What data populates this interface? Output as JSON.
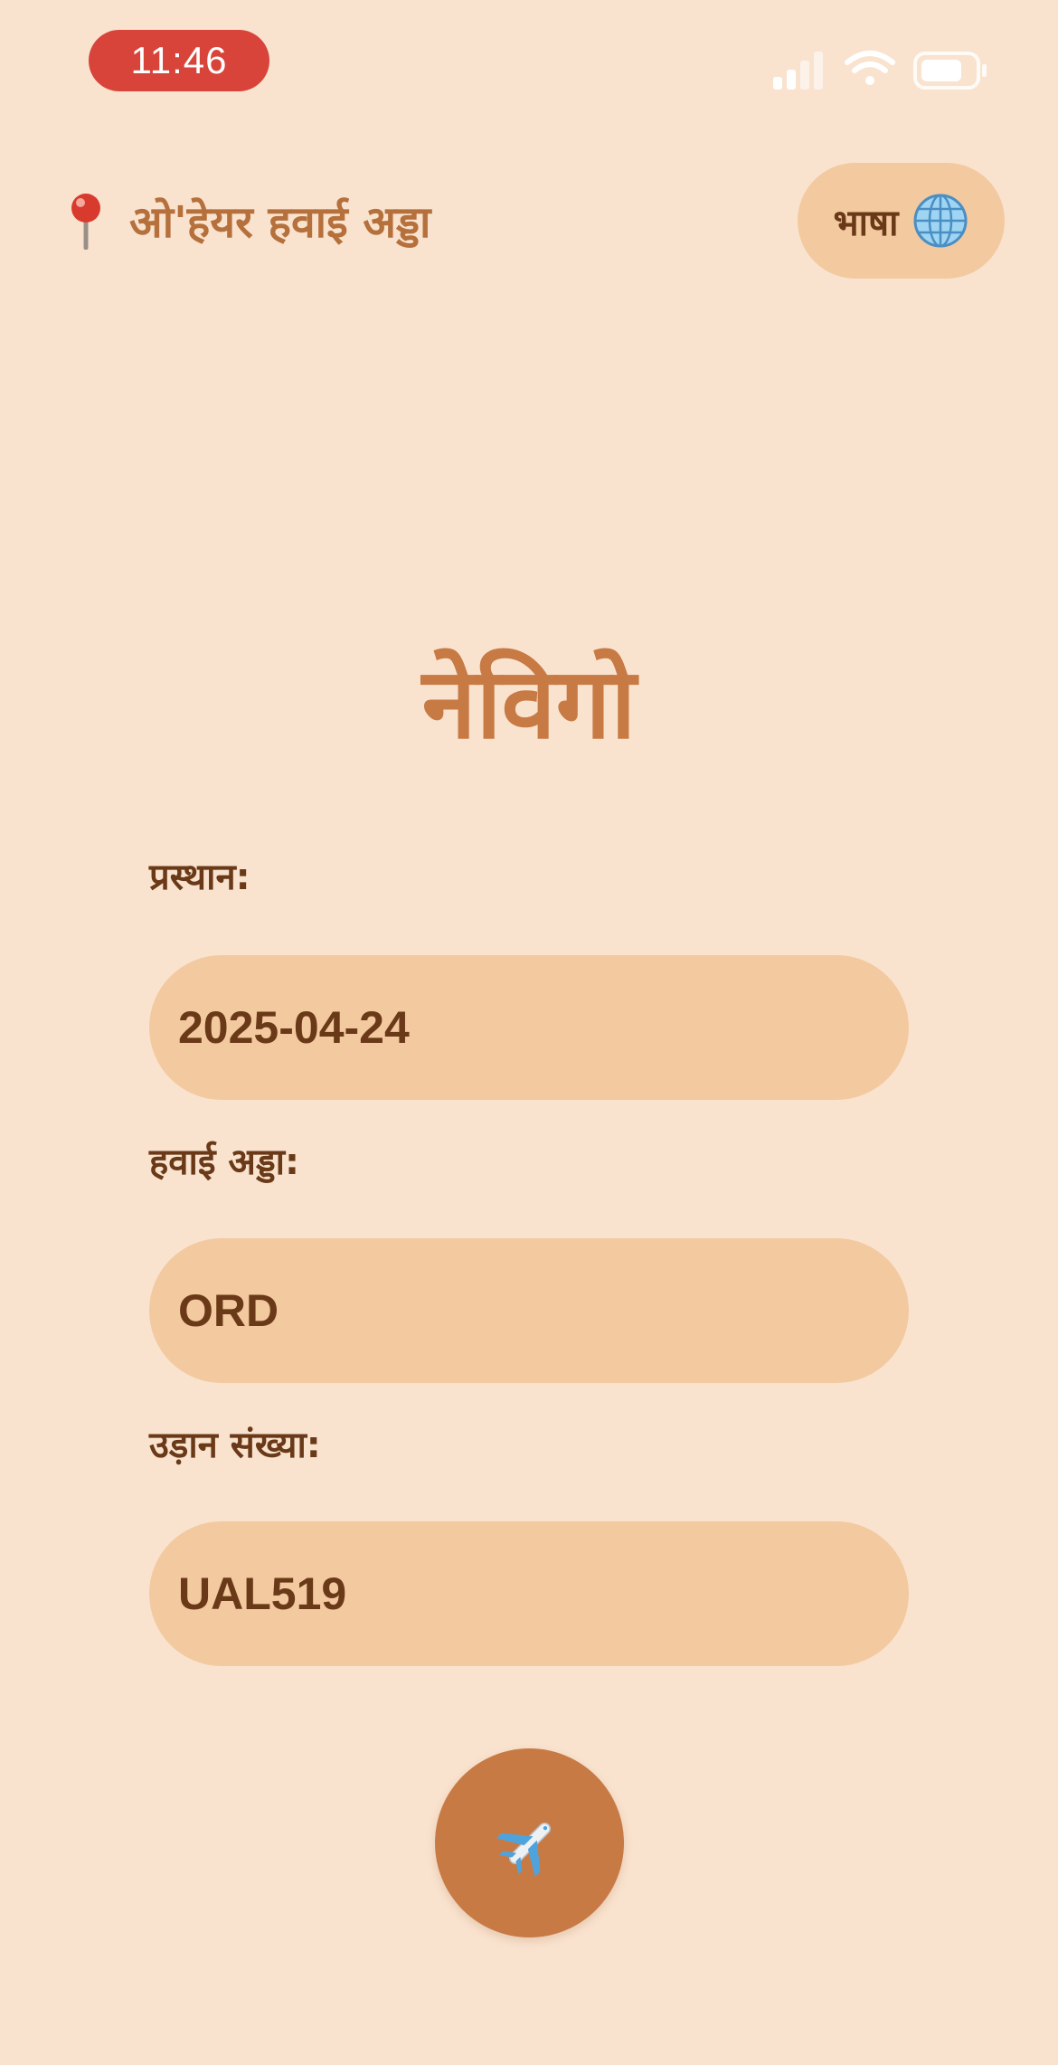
{
  "status_bar": {
    "time": "11:46"
  },
  "header": {
    "location_icon": "map-pin-icon",
    "location_label": "ओ'हेयर हवाई अड्डा",
    "language_button": {
      "label": "भाषा",
      "icon": "globe-icon"
    }
  },
  "app": {
    "title": "नेविगो"
  },
  "form": {
    "departure": {
      "label": "प्रस्थान:",
      "value": "2025-04-24"
    },
    "airport": {
      "label": "हवाई अड्डा:",
      "value": "ORD"
    },
    "flight_number": {
      "label": "उड़ान संख्या:",
      "value": "UAL519"
    },
    "submit": {
      "icon": "airplane-icon"
    }
  },
  "colors": {
    "background": "#f9e3cf",
    "field": "#f3c9a0",
    "accent": "#c87a45",
    "text_dark": "#6a3a18",
    "time_pill": "#d8443a"
  }
}
